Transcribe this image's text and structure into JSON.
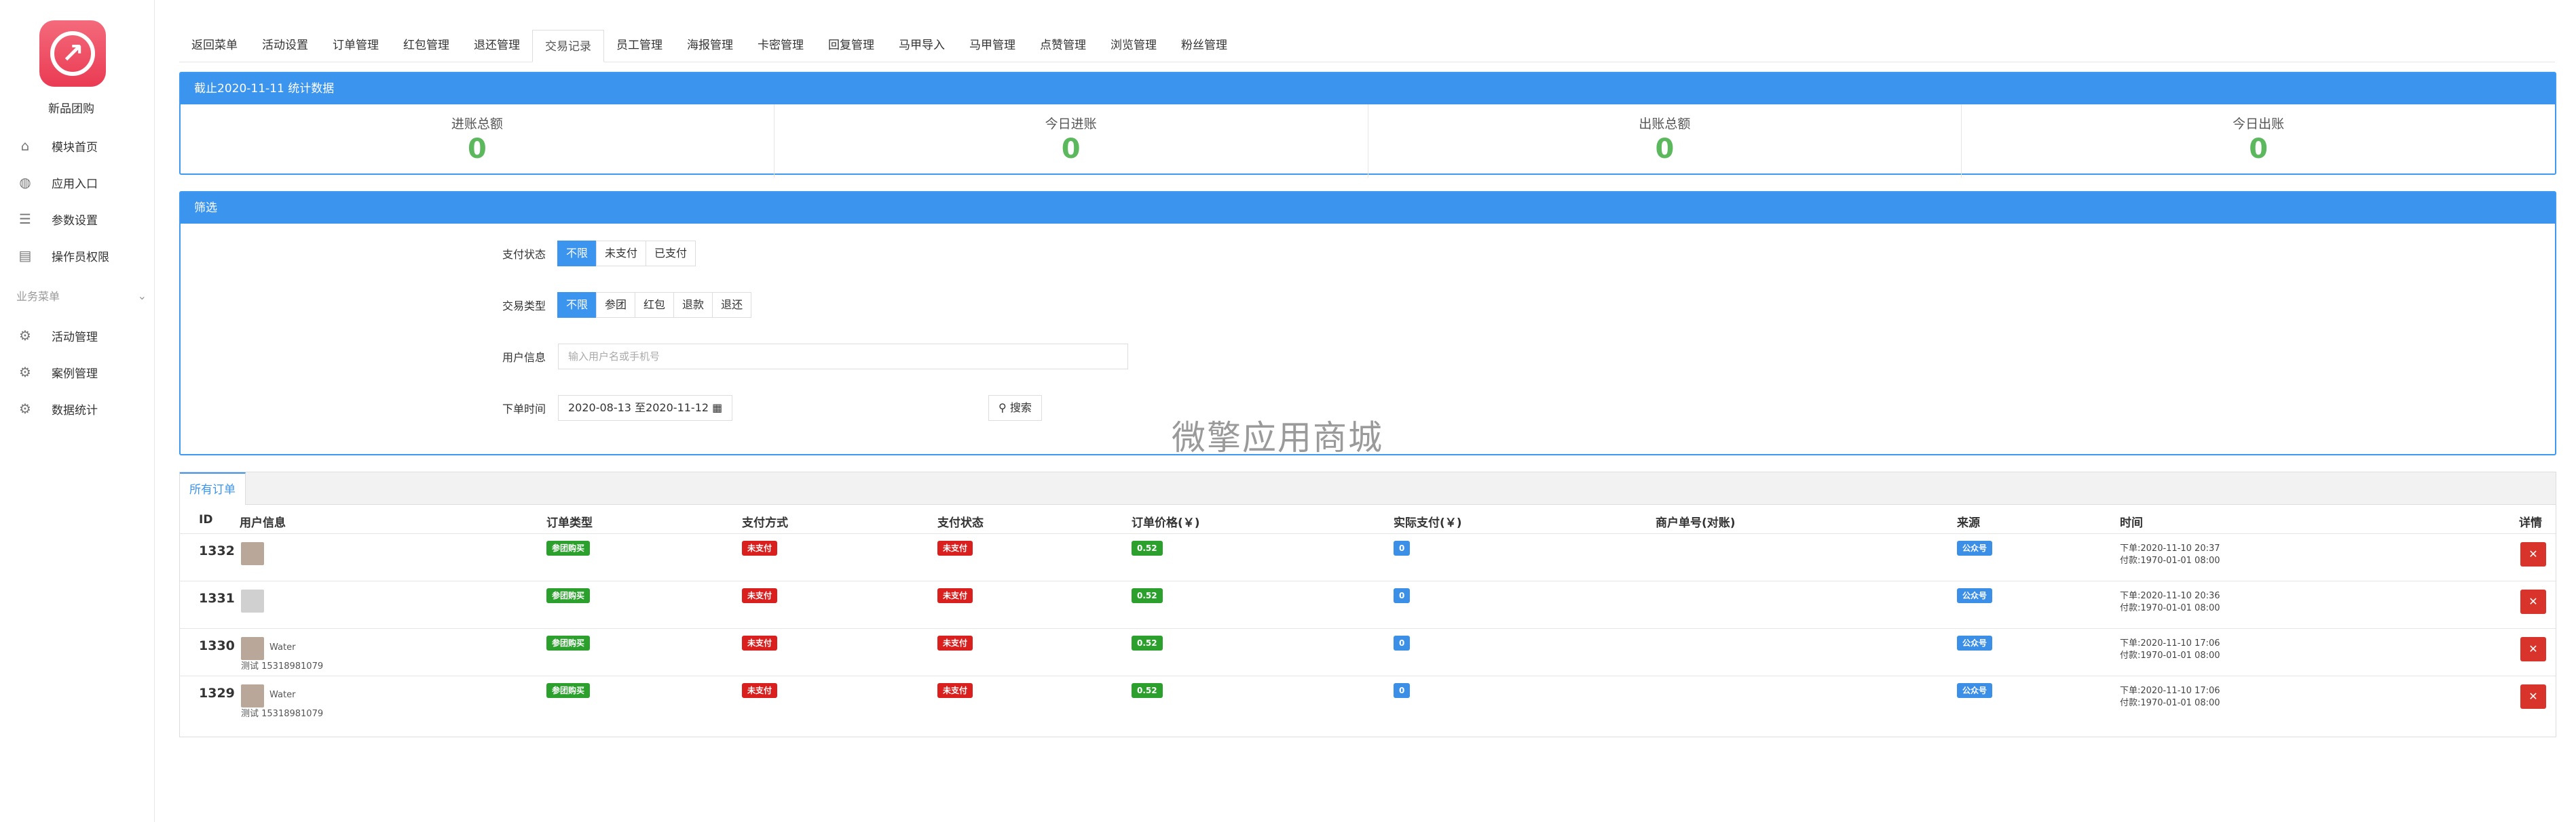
{
  "sidebar": {
    "app_name": "新品团购",
    "logo_icon": "logo-icon",
    "items": [
      {
        "label": "模块首页",
        "icon": "home-icon"
      },
      {
        "label": "应用入口",
        "icon": "chat-icon"
      },
      {
        "label": "参数设置",
        "icon": "list-icon"
      },
      {
        "label": "操作员权限",
        "icon": "document-edit-icon"
      }
    ],
    "section_title": "业务菜单",
    "section_items": [
      {
        "label": "活动管理",
        "icon": "gear-icon"
      },
      {
        "label": "案例管理",
        "icon": "gear-icon"
      },
      {
        "label": "数据统计",
        "icon": "gear-icon"
      }
    ]
  },
  "tabs": [
    "返回菜单",
    "活动设置",
    "订单管理",
    "红包管理",
    "退还管理",
    "交易记录",
    "员工管理",
    "海报管理",
    "卡密管理",
    "回复管理",
    "马甲导入",
    "马甲管理",
    "点赞管理",
    "浏览管理",
    "粉丝管理"
  ],
  "active_tab": "交易记录",
  "stats_panel": {
    "title": "截止2020-11-11 统计数据",
    "stats": [
      {
        "label": "进账总额",
        "value": "0"
      },
      {
        "label": "今日进账",
        "value": "0"
      },
      {
        "label": "出账总额",
        "value": "0"
      },
      {
        "label": "今日出账",
        "value": "0"
      }
    ]
  },
  "filter_panel": {
    "title": "筛选",
    "pay_status": {
      "label": "支付状态",
      "options": [
        "不限",
        "未支付",
        "已支付"
      ],
      "selected": "不限"
    },
    "trade_type": {
      "label": "交易类型",
      "options": [
        "不限",
        "参团",
        "红包",
        "退款",
        "退还"
      ],
      "selected": "不限"
    },
    "user_info": {
      "label": "用户信息",
      "placeholder": "输入用户名或手机号",
      "value": ""
    },
    "order_time": {
      "label": "下单时间",
      "range": "2020-08-13 至2020-11-12"
    },
    "search_label": "搜索"
  },
  "watermark": "微擎应用商城",
  "orders": {
    "tab_label": "所有订单",
    "columns": [
      "ID",
      "用户信息",
      "订单类型",
      "支付方式",
      "支付状态",
      "订单价格(￥)",
      "实际支付(￥)",
      "商户单号(对账)",
      "来源",
      "时间",
      "详情"
    ],
    "rows": [
      {
        "id": "1332",
        "name": "",
        "phone": "",
        "type": "参团购买",
        "pay_method": "未支付",
        "pay_status": "未支付",
        "price": "0.52",
        "paid": "0",
        "merchant_no": "",
        "source": "公众号",
        "order_time": "下单:2020-11-10 20:37",
        "pay_time": "付款:1970-01-01 08:00"
      },
      {
        "id": "1331",
        "name": "",
        "phone": "",
        "type": "参团购买",
        "pay_method": "未支付",
        "pay_status": "未支付",
        "price": "0.52",
        "paid": "0",
        "merchant_no": "",
        "source": "公众号",
        "order_time": "下单:2020-11-10 20:36",
        "pay_time": "付款:1970-01-01 08:00"
      },
      {
        "id": "1330",
        "name": "Water",
        "phone": "测试 15318981079",
        "type": "参团购买",
        "pay_method": "未支付",
        "pay_status": "未支付",
        "price": "0.52",
        "paid": "0",
        "merchant_no": "",
        "source": "公众号",
        "order_time": "下单:2020-11-10 17:06",
        "pay_time": "付款:1970-01-01 08:00"
      },
      {
        "id": "1329",
        "name": "Water",
        "phone": "测试 15318981079",
        "type": "参团购买",
        "pay_method": "未支付",
        "pay_status": "未支付",
        "price": "0.52",
        "paid": "0",
        "merchant_no": "",
        "source": "公众号",
        "order_time": "下单:2020-11-10 17:06",
        "pay_time": "付款:1970-01-01 08:00"
      }
    ]
  },
  "colors": {
    "primary": "#3b94ee",
    "success": "#5cb85c",
    "danger": "#d9201f",
    "label_green": "#2ca02c",
    "label_blue": "#3b8fe6"
  }
}
